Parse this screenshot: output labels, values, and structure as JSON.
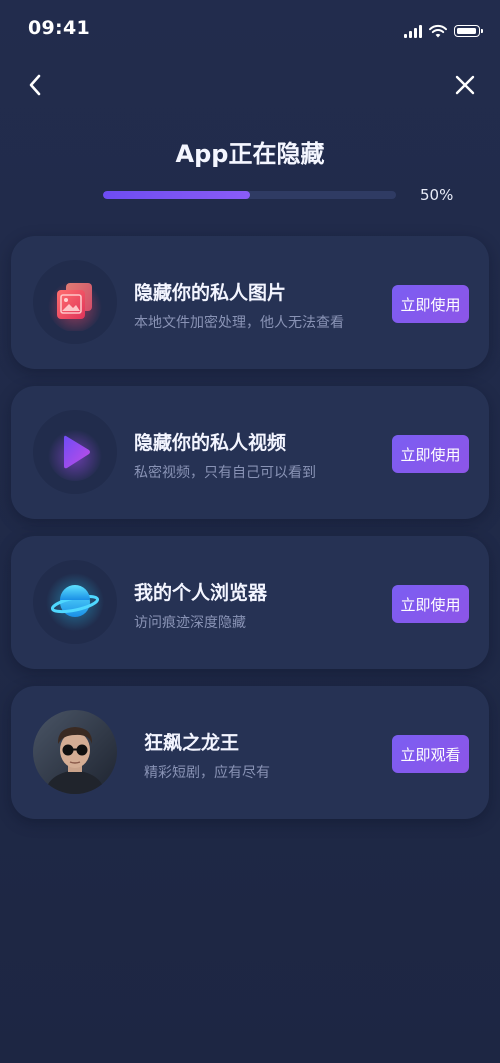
{
  "status_bar": {
    "time": "09:41",
    "icons": [
      "signal-icon",
      "wifi-icon",
      "battery-icon"
    ]
  },
  "nav": {
    "back_icon": "chevron-left-icon",
    "close_icon": "close-icon"
  },
  "header": {
    "title": "App正在隐藏"
  },
  "progress": {
    "value": 0.5,
    "label": "50%",
    "color": "#6d4cf3"
  },
  "cards": [
    {
      "icon": "photo-icon",
      "title": "隐藏你的私人图片",
      "subtitle": "本地文件加密处理，他人无法查看",
      "button": "立即使用"
    },
    {
      "icon": "play-icon",
      "title": "隐藏你的私人视频",
      "subtitle": "私密视频，只有自己可以看到",
      "button": "立即使用"
    },
    {
      "icon": "planet-icon",
      "title": "我的个人浏览器",
      "subtitle": "访问痕迹深度隐藏",
      "button": "立即使用"
    },
    {
      "icon": "avatar",
      "title": "狂飙之龙王",
      "subtitle": "精彩短剧，应有尽有",
      "button": "立即观看"
    }
  ],
  "colors": {
    "background": "#1f2948",
    "card": "#263254",
    "accent": "#7b5ef2",
    "subtitle": "#8993b5"
  }
}
